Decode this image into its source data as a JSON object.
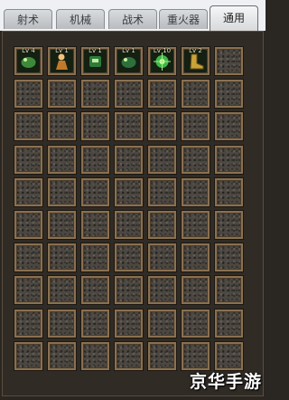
{
  "tabs": [
    {
      "label": "射术",
      "active": false
    },
    {
      "label": "机械",
      "active": false
    },
    {
      "label": "战术",
      "active": false
    },
    {
      "label": "重火器",
      "active": false
    },
    {
      "label": "通用",
      "active": true
    }
  ],
  "grid": {
    "rows": 10,
    "cols": 7
  },
  "skills": [
    {
      "slot": 0,
      "level": "Lv 4",
      "icon": "green-beast-skill-icon",
      "color": "#3f8a3a"
    },
    {
      "slot": 1,
      "level": "Lv 1",
      "icon": "orange-figure-skill-icon",
      "color": "#c27a2a"
    },
    {
      "slot": 2,
      "level": "Lv 1",
      "icon": "green-mech-skill-icon",
      "color": "#2f7a3a"
    },
    {
      "slot": 3,
      "level": "Lv 1",
      "icon": "green-creature-skill-icon",
      "color": "#2e6f3b"
    },
    {
      "slot": 4,
      "level": "Lv 10",
      "icon": "green-orb-skill-icon",
      "color": "#3fb84a"
    },
    {
      "slot": 5,
      "level": "Lv 2",
      "icon": "golden-boot-skill-icon",
      "color": "#c9a23a"
    }
  ],
  "watermark": "京华手游"
}
